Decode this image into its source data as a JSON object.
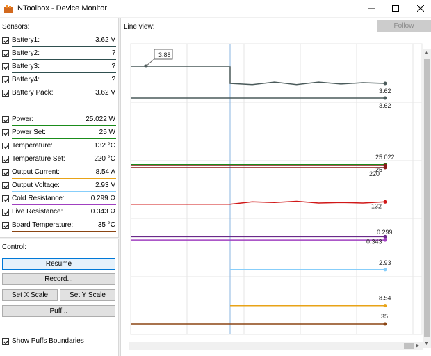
{
  "window": {
    "title": "NToolbox - Device Monitor",
    "icon": "ntoolbox-app-icon",
    "buttons": {
      "minimize": "minimize-icon",
      "maximize": "maximize-icon",
      "close": "close-icon"
    }
  },
  "sensors": {
    "title": "Sensors:",
    "items": [
      {
        "label": "Battery1:",
        "value": "3.62 V",
        "checked": true,
        "color": "#2f4f4f"
      },
      {
        "label": "Battery2:",
        "value": "?",
        "checked": true,
        "color": "#2f4f4f"
      },
      {
        "label": "Battery3:",
        "value": "?",
        "checked": true,
        "color": "#2f4f4f"
      },
      {
        "label": "Battery4:",
        "value": "?",
        "checked": true,
        "color": "#2f4f4f"
      },
      {
        "label": "Battery Pack:",
        "value": "3.62 V",
        "checked": true,
        "color": "#2f4f4f"
      },
      {
        "label": "Power:",
        "value": "25.022 W",
        "checked": true,
        "color": "#1a8c1a"
      },
      {
        "label": "Power Set:",
        "value": "25 W",
        "checked": true,
        "color": "#1a8c1a"
      },
      {
        "label": "Temperature:",
        "value": "132 °C",
        "checked": true,
        "color": "#c0141a"
      },
      {
        "label": "Temperature Set:",
        "value": "220 °C",
        "checked": true,
        "color": "#8b1a1a"
      },
      {
        "label": "Output Current:",
        "value": "8.54 A",
        "checked": true,
        "color": "#e8a317"
      },
      {
        "label": "Output Voltage:",
        "value": "2.93 V",
        "checked": true,
        "color": "#87cefa"
      },
      {
        "label": "Cold Resistance:",
        "value": "0.299 Ω",
        "checked": true,
        "color": "#a040c0"
      },
      {
        "label": "Live Resistance:",
        "value": "0.343 Ω",
        "checked": true,
        "color": "#6a2a8a"
      },
      {
        "label": "Board Temperature:",
        "value": "35 °C",
        "checked": true,
        "color": "#8b4513"
      }
    ]
  },
  "control": {
    "title": "Control:",
    "resume": "Resume",
    "record": "Record...",
    "set_x_scale": "Set X Scale",
    "set_y_scale": "Set Y Scale",
    "puff": "Puff...",
    "show_puffs_label": "Show Puffs Boundaries",
    "show_puffs_checked": true
  },
  "line_view": {
    "title": "Line view:",
    "follow": "Follow",
    "follow_enabled": false
  },
  "chart_data": {
    "type": "line",
    "title": "",
    "xlabel": "",
    "ylabel": "",
    "grid": true,
    "legend": "none",
    "tooltip": {
      "series": "Battery1",
      "value": "3.88"
    },
    "series": [
      {
        "name": "Battery1",
        "color": "#4a5a5a",
        "end_label": "3.62",
        "values": [
          3.88,
          3.88,
          3.88,
          3.88,
          3.88,
          3.62,
          3.6,
          3.64,
          3.6,
          3.64,
          3.61,
          3.63,
          3.62
        ]
      },
      {
        "name": "Battery Pack",
        "color": "#4a5a5a",
        "end_label": "3.62",
        "values": [
          3.62,
          3.62,
          3.62,
          3.62,
          3.62,
          3.62,
          3.62,
          3.62,
          3.62,
          3.62,
          3.62,
          3.62,
          3.62
        ]
      },
      {
        "name": "Power",
        "color": "#1a8c1a",
        "end_label": "25.022",
        "values": [
          25.02,
          25.02,
          25.02,
          25.02,
          25.02,
          25.02,
          25.02,
          25.02,
          25.02,
          25.02,
          25.02,
          25.02,
          25.022
        ]
      },
      {
        "name": "Power Set",
        "color": "#8b1a1a",
        "end_label": "25",
        "values": [
          25,
          25,
          25,
          25,
          25,
          25,
          25,
          25,
          25,
          25,
          25,
          25,
          25
        ]
      },
      {
        "name": "Temperature Set",
        "color": "#8b1a1a",
        "end_label": "220",
        "values": [
          220,
          220,
          220,
          220,
          220,
          220,
          220,
          220,
          220,
          220,
          220,
          220,
          220
        ]
      },
      {
        "name": "Temperature",
        "color": "#d01818",
        "end_label": "132",
        "values": [
          128,
          128,
          128,
          128,
          128,
          128,
          132,
          131,
          133,
          130,
          131,
          130,
          132
        ]
      },
      {
        "name": "Cold Resistance",
        "color": "#a040c0",
        "end_label": "0.299",
        "values": [
          0.299,
          0.299,
          0.299,
          0.299,
          0.299,
          0.299,
          0.299,
          0.299,
          0.299,
          0.299,
          0.299,
          0.299,
          0.299
        ]
      },
      {
        "name": "Live Resistance",
        "color": "#6a2a8a",
        "end_label": "0.343",
        "values": [
          0.343,
          0.343,
          0.343,
          0.343,
          0.343,
          0.343,
          0.343,
          0.343,
          0.343,
          0.343,
          0.343,
          0.343,
          0.343
        ]
      },
      {
        "name": "Output Voltage",
        "color": "#87cefa",
        "end_label": "2.93",
        "values": [
          null,
          null,
          null,
          null,
          null,
          2.93,
          2.93,
          2.93,
          2.93,
          2.93,
          2.93,
          2.93,
          2.93
        ]
      },
      {
        "name": "Output Current",
        "color": "#e8a317",
        "end_label": "8.54",
        "values": [
          null,
          null,
          null,
          null,
          null,
          8.54,
          8.54,
          8.54,
          8.54,
          8.54,
          8.54,
          8.54,
          8.54
        ]
      },
      {
        "name": "Board Temperature",
        "color": "#8b4513",
        "end_label": "35",
        "values": [
          35,
          35,
          35,
          35,
          35,
          35,
          35,
          35,
          35,
          35,
          35,
          35,
          35
        ]
      }
    ]
  }
}
